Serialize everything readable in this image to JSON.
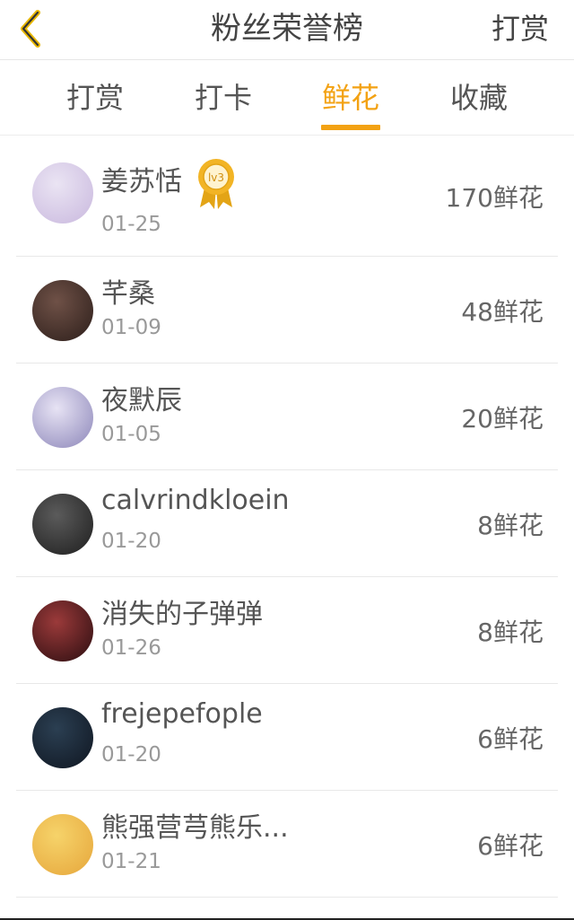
{
  "header": {
    "title": "粉丝荣誉榜",
    "right_button": "打赏",
    "back_icon": "chevron-left-icon",
    "accent_color": "#f3a213"
  },
  "tabs": [
    {
      "label": "打赏",
      "active": false
    },
    {
      "label": "打卡",
      "active": false
    },
    {
      "label": "鲜花",
      "active": true
    },
    {
      "label": "收藏",
      "active": false
    }
  ],
  "list": [
    {
      "name": "姜苏恬",
      "date": "01-25",
      "count": "170鲜花",
      "badge": "lv3",
      "avatar_colors": [
        "#eae4f3",
        "#c9b8de"
      ]
    },
    {
      "name": "芊桑",
      "date": "01-09",
      "count": "48鲜花",
      "badge": "",
      "avatar_colors": [
        "#6f5147",
        "#2c1e1a"
      ]
    },
    {
      "name": "夜默辰",
      "date": "01-05",
      "count": "20鲜花",
      "badge": "",
      "avatar_colors": [
        "#e7e3f4",
        "#8c86b9"
      ]
    },
    {
      "name": "calvrindkloein",
      "date": "01-20",
      "count": "8鲜花",
      "badge": "",
      "avatar_colors": [
        "#5b5b5b",
        "#1e1e1e"
      ]
    },
    {
      "name": "消失的子弹弹",
      "date": "01-26",
      "count": "8鲜花",
      "badge": "",
      "avatar_colors": [
        "#9b3a3a",
        "#2a0d10"
      ]
    },
    {
      "name": "frejepefople",
      "date": "01-20",
      "count": "6鲜花",
      "badge": "",
      "avatar_colors": [
        "#2b3f52",
        "#0f1621"
      ]
    },
    {
      "name": "熊强营芎熊乐...",
      "date": "01-21",
      "count": "6鲜花",
      "badge": "",
      "avatar_colors": [
        "#f6d36a",
        "#e6a63b"
      ]
    }
  ]
}
